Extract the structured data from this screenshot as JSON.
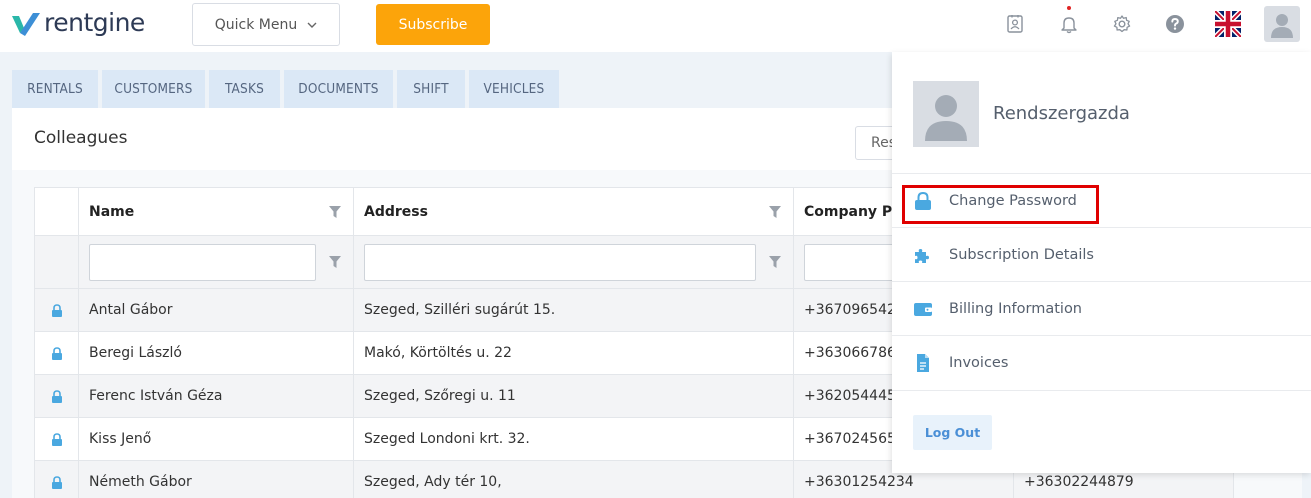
{
  "brand": {
    "name": "rentgine"
  },
  "topbar": {
    "quick_menu": "Quick Menu",
    "subscribe": "Subscribe",
    "icons": [
      "contact-card-icon",
      "bell-icon",
      "gear-icon",
      "help-icon",
      "uk-flag-icon",
      "user-avatar-icon"
    ]
  },
  "tabs": [
    "RENTALS",
    "CUSTOMERS",
    "TASKS",
    "DOCUMENTS",
    "SHIFT",
    "VEHICLES"
  ],
  "page": {
    "title": "Colleagues",
    "reset_label": "Res"
  },
  "table": {
    "columns": [
      "Name",
      "Address",
      "Company Ph"
    ],
    "rows": [
      {
        "name": "Antal Gábor",
        "address": "Szeged, Szilléri sugárút 15.",
        "company_phone": "+367096542",
        "extra": ""
      },
      {
        "name": "Beregi László",
        "address": "Makó, Körtöltés u. 22",
        "company_phone": "+363066786",
        "extra": ""
      },
      {
        "name": "Ferenc István Géza",
        "address": "Szeged, Szőregi u. 11",
        "company_phone": "+362054445",
        "extra": ""
      },
      {
        "name": "Kiss Jenő",
        "address": "Szeged Londoni krt. 32.",
        "company_phone": "+367024565",
        "extra": ""
      },
      {
        "name": "Németh Gábor",
        "address": "Szeged, Ady tér 10,",
        "company_phone": "+36301254234",
        "extra": "+36302244879"
      }
    ]
  },
  "user_menu": {
    "username": "Rendszergazda",
    "items": [
      {
        "label": "Change Password",
        "icon": "lock-icon"
      },
      {
        "label": "Subscription Details",
        "icon": "puzzle-icon"
      },
      {
        "label": "Billing Information",
        "icon": "wallet-icon"
      },
      {
        "label": "Invoices",
        "icon": "document-icon"
      }
    ],
    "logout": "Log Out"
  },
  "colors": {
    "accent": "#4aa8e0",
    "subscribe": "#fca40a",
    "highlight": "#e00000",
    "tab_bg": "#dbe8f6"
  }
}
